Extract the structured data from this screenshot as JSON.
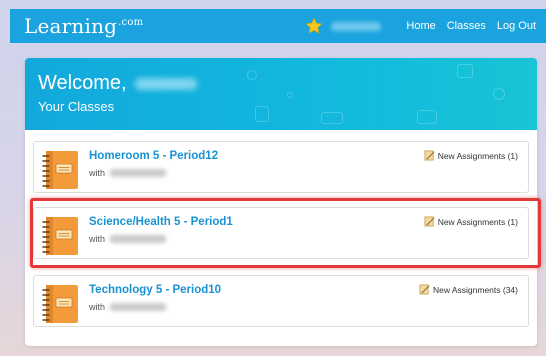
{
  "nav": {
    "logo_text": "Learning",
    "logo_sup": ".com",
    "links": [
      "Home",
      "Classes",
      "Log Out"
    ],
    "brand_color": "#1aa3de"
  },
  "banner": {
    "welcome": "Welcome,",
    "subtitle": "Your Classes"
  },
  "classes": [
    {
      "title": "Homeroom 5 - Period12",
      "with": "with",
      "assignments": "New Assignments (1)"
    },
    {
      "title": "Science/Health 5 - Period1",
      "with": "with",
      "assignments": "New Assignments (1)"
    },
    {
      "title": "Technology 5 - Period10",
      "with": "with",
      "assignments": "New Assignments (34)"
    }
  ],
  "icons": {
    "star": "star-icon",
    "book": "notebook-icon",
    "assignment": "assignment-icon"
  },
  "highlight_color": "#e2393b"
}
